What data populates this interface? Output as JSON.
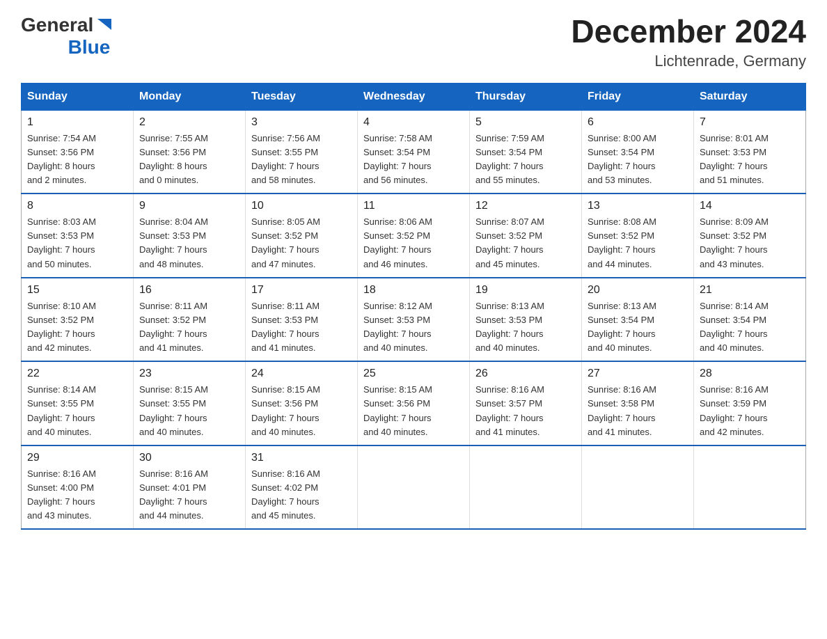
{
  "logo": {
    "general": "General",
    "arrow": "▶",
    "blue": "Blue"
  },
  "title": {
    "month_year": "December 2024",
    "location": "Lichtenrade, Germany"
  },
  "days_of_week": [
    "Sunday",
    "Monday",
    "Tuesday",
    "Wednesday",
    "Thursday",
    "Friday",
    "Saturday"
  ],
  "weeks": [
    [
      {
        "day": "1",
        "sunrise": "7:54 AM",
        "sunset": "3:56 PM",
        "daylight": "8 hours and 2 minutes."
      },
      {
        "day": "2",
        "sunrise": "7:55 AM",
        "sunset": "3:56 PM",
        "daylight": "8 hours and 0 minutes."
      },
      {
        "day": "3",
        "sunrise": "7:56 AM",
        "sunset": "3:55 PM",
        "daylight": "7 hours and 58 minutes."
      },
      {
        "day": "4",
        "sunrise": "7:58 AM",
        "sunset": "3:54 PM",
        "daylight": "7 hours and 56 minutes."
      },
      {
        "day": "5",
        "sunrise": "7:59 AM",
        "sunset": "3:54 PM",
        "daylight": "7 hours and 55 minutes."
      },
      {
        "day": "6",
        "sunrise": "8:00 AM",
        "sunset": "3:54 PM",
        "daylight": "7 hours and 53 minutes."
      },
      {
        "day": "7",
        "sunrise": "8:01 AM",
        "sunset": "3:53 PM",
        "daylight": "7 hours and 51 minutes."
      }
    ],
    [
      {
        "day": "8",
        "sunrise": "8:03 AM",
        "sunset": "3:53 PM",
        "daylight": "7 hours and 50 minutes."
      },
      {
        "day": "9",
        "sunrise": "8:04 AM",
        "sunset": "3:53 PM",
        "daylight": "7 hours and 48 minutes."
      },
      {
        "day": "10",
        "sunrise": "8:05 AM",
        "sunset": "3:52 PM",
        "daylight": "7 hours and 47 minutes."
      },
      {
        "day": "11",
        "sunrise": "8:06 AM",
        "sunset": "3:52 PM",
        "daylight": "7 hours and 46 minutes."
      },
      {
        "day": "12",
        "sunrise": "8:07 AM",
        "sunset": "3:52 PM",
        "daylight": "7 hours and 45 minutes."
      },
      {
        "day": "13",
        "sunrise": "8:08 AM",
        "sunset": "3:52 PM",
        "daylight": "7 hours and 44 minutes."
      },
      {
        "day": "14",
        "sunrise": "8:09 AM",
        "sunset": "3:52 PM",
        "daylight": "7 hours and 43 minutes."
      }
    ],
    [
      {
        "day": "15",
        "sunrise": "8:10 AM",
        "sunset": "3:52 PM",
        "daylight": "7 hours and 42 minutes."
      },
      {
        "day": "16",
        "sunrise": "8:11 AM",
        "sunset": "3:52 PM",
        "daylight": "7 hours and 41 minutes."
      },
      {
        "day": "17",
        "sunrise": "8:11 AM",
        "sunset": "3:53 PM",
        "daylight": "7 hours and 41 minutes."
      },
      {
        "day": "18",
        "sunrise": "8:12 AM",
        "sunset": "3:53 PM",
        "daylight": "7 hours and 40 minutes."
      },
      {
        "day": "19",
        "sunrise": "8:13 AM",
        "sunset": "3:53 PM",
        "daylight": "7 hours and 40 minutes."
      },
      {
        "day": "20",
        "sunrise": "8:13 AM",
        "sunset": "3:54 PM",
        "daylight": "7 hours and 40 minutes."
      },
      {
        "day": "21",
        "sunrise": "8:14 AM",
        "sunset": "3:54 PM",
        "daylight": "7 hours and 40 minutes."
      }
    ],
    [
      {
        "day": "22",
        "sunrise": "8:14 AM",
        "sunset": "3:55 PM",
        "daylight": "7 hours and 40 minutes."
      },
      {
        "day": "23",
        "sunrise": "8:15 AM",
        "sunset": "3:55 PM",
        "daylight": "7 hours and 40 minutes."
      },
      {
        "day": "24",
        "sunrise": "8:15 AM",
        "sunset": "3:56 PM",
        "daylight": "7 hours and 40 minutes."
      },
      {
        "day": "25",
        "sunrise": "8:15 AM",
        "sunset": "3:56 PM",
        "daylight": "7 hours and 40 minutes."
      },
      {
        "day": "26",
        "sunrise": "8:16 AM",
        "sunset": "3:57 PM",
        "daylight": "7 hours and 41 minutes."
      },
      {
        "day": "27",
        "sunrise": "8:16 AM",
        "sunset": "3:58 PM",
        "daylight": "7 hours and 41 minutes."
      },
      {
        "day": "28",
        "sunrise": "8:16 AM",
        "sunset": "3:59 PM",
        "daylight": "7 hours and 42 minutes."
      }
    ],
    [
      {
        "day": "29",
        "sunrise": "8:16 AM",
        "sunset": "4:00 PM",
        "daylight": "7 hours and 43 minutes."
      },
      {
        "day": "30",
        "sunrise": "8:16 AM",
        "sunset": "4:01 PM",
        "daylight": "7 hours and 44 minutes."
      },
      {
        "day": "31",
        "sunrise": "8:16 AM",
        "sunset": "4:02 PM",
        "daylight": "7 hours and 45 minutes."
      },
      null,
      null,
      null,
      null
    ]
  ]
}
